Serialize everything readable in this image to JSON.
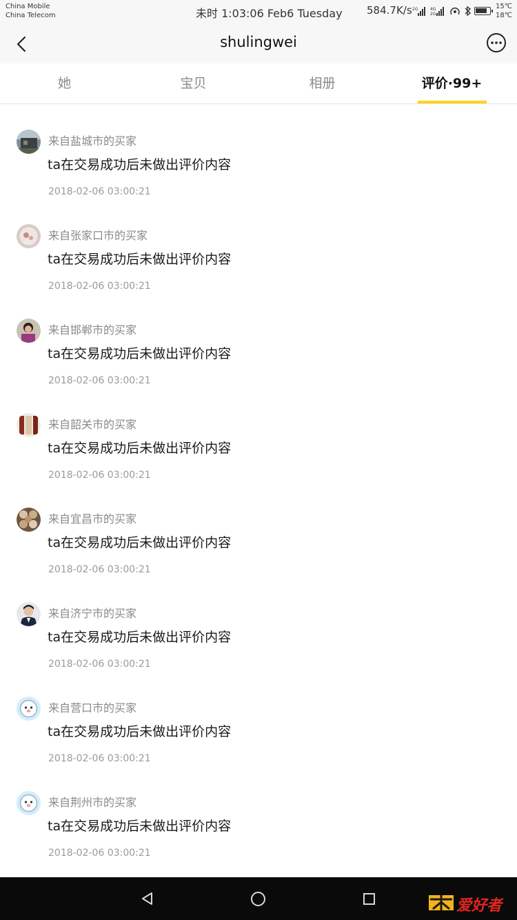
{
  "status_bar": {
    "carrier_1": "China Mobile",
    "carrier_2": "China Telecom",
    "time": "未时 1:03:06 Feb6 Tuesday",
    "network_speed": "584.7K/s",
    "temp_high": "15℃",
    "temp_low": "18℃"
  },
  "nav": {
    "title": "shulingwei",
    "back_icon": "chevron-left-icon",
    "more_icon": "more-dots-icon"
  },
  "tabs": [
    {
      "label": "她",
      "active": false
    },
    {
      "label": "宝贝",
      "active": false
    },
    {
      "label": "相册",
      "active": false
    },
    {
      "label": "评价·99+",
      "active": true
    }
  ],
  "accent_color": "#ffd31a",
  "reviews": [
    {
      "buyer": "来自盐城市的买家",
      "content": "ta在交易成功后未做出评价内容",
      "date": "2018-02-06 03:00:21"
    },
    {
      "buyer": "来自张家口市的买家",
      "content": "ta在交易成功后未做出评价内容",
      "date": "2018-02-06 03:00:21"
    },
    {
      "buyer": "来自邯郸市的买家",
      "content": "ta在交易成功后未做出评价内容",
      "date": "2018-02-06 03:00:21"
    },
    {
      "buyer": "来自韶关市的买家",
      "content": "ta在交易成功后未做出评价内容",
      "date": "2018-02-06 03:00:21"
    },
    {
      "buyer": "来自宜昌市的买家",
      "content": "ta在交易成功后未做出评价内容",
      "date": "2018-02-06 03:00:21"
    },
    {
      "buyer": "来自济宁市的买家",
      "content": "ta在交易成功后未做出评价内容",
      "date": "2018-02-06 03:00:21"
    },
    {
      "buyer": "来自营口市的买家",
      "content": "ta在交易成功后未做出评价内容",
      "date": "2018-02-06 03:00:21"
    },
    {
      "buyer": "来自荆州市的买家",
      "content": "ta在交易成功后未做出评价内容",
      "date": "2018-02-06 03:00:21"
    }
  ],
  "watermark": "大正爱好者"
}
